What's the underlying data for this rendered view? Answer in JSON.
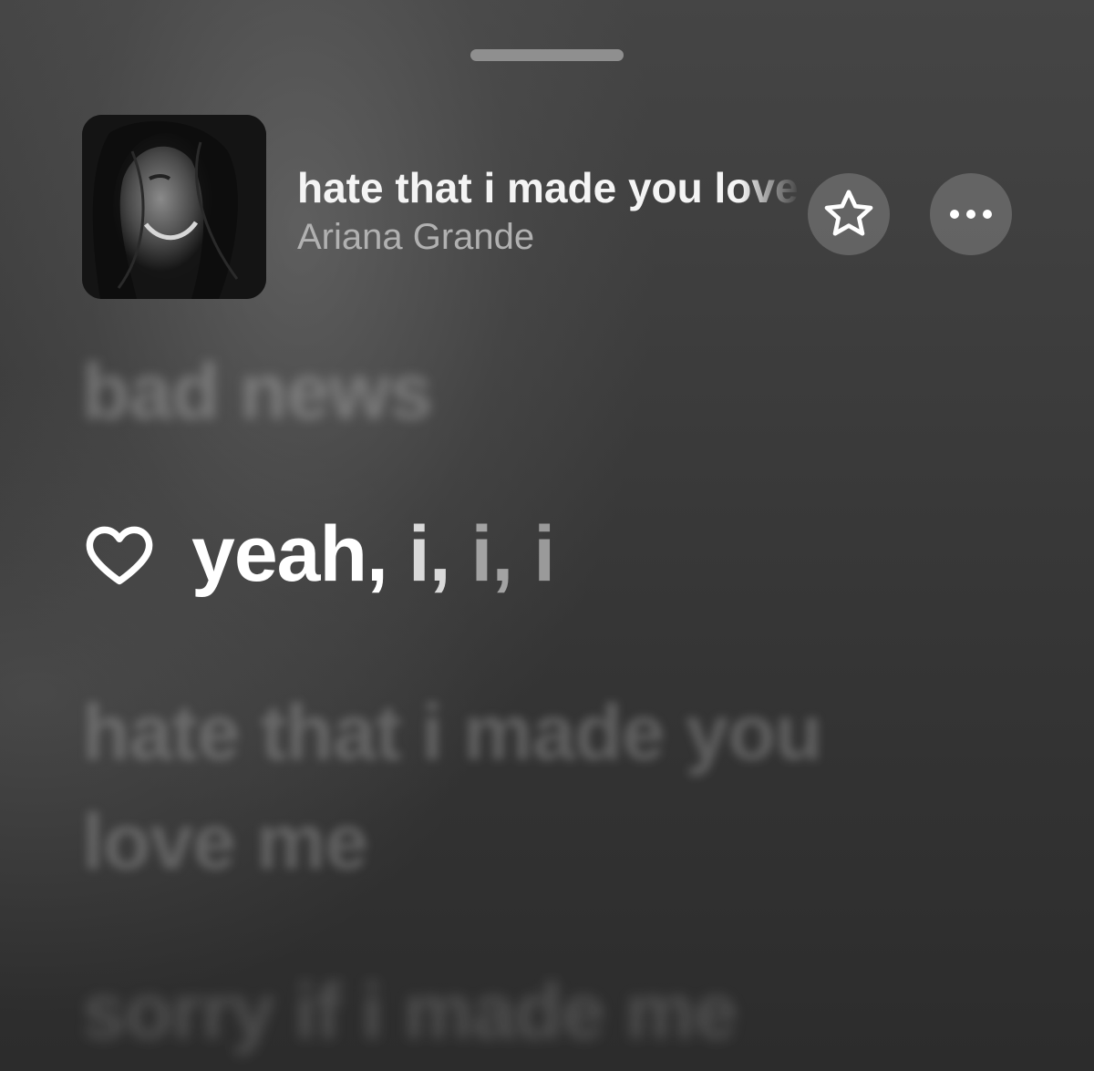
{
  "now_playing": {
    "title": "hate that i made you love me",
    "artist": "Ariana Grande",
    "artwork_icon": "album-artwork",
    "favorite_icon": "star-icon",
    "more_icon": "ellipsis-icon"
  },
  "lyrics": {
    "previous_line": "bad news",
    "current_line": {
      "marker_icon": "heart-icon",
      "words": [
        "yeah,",
        "i,",
        "i,",
        "i"
      ]
    },
    "next_line": [
      "hate that i made you",
      "love me"
    ],
    "later_line": "sorry if i made me"
  },
  "colors": {
    "background": "#3a3a3a",
    "active_lyric": "#ffffff",
    "artist_text": "#b1b1b1",
    "button_fill": "#6e6e6e"
  }
}
